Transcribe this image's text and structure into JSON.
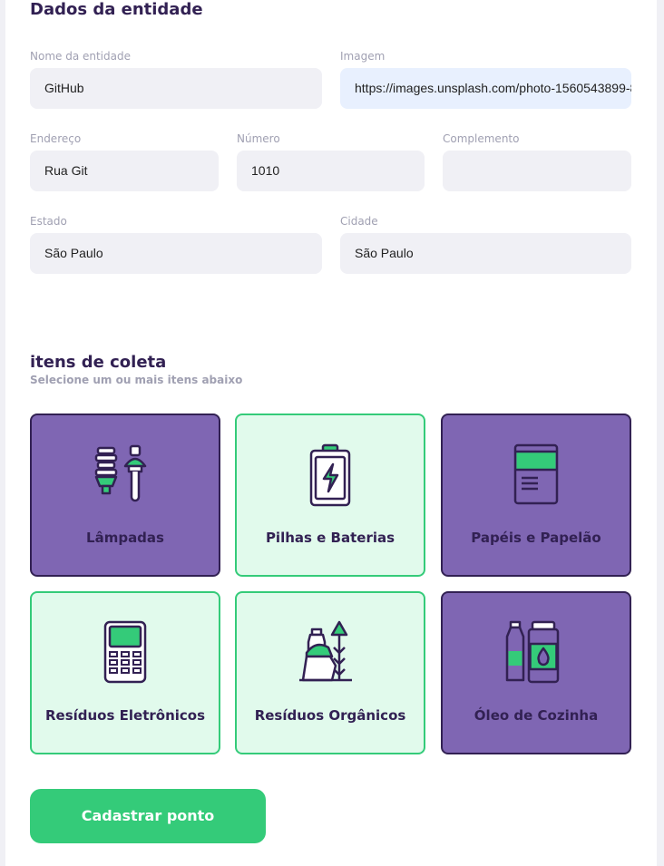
{
  "section_entity": {
    "title": "Dados da entidade",
    "name_label": "Nome da entidade",
    "name_value": "GitHub",
    "image_label": "Imagem",
    "image_value": "https://images.unsplash.com/photo-1560543899-8",
    "address_label": "Endereço",
    "address_value": "Rua Git",
    "number_label": "Número",
    "number_value": "1010",
    "complement_label": "Complemento",
    "complement_value": "",
    "state_label": "Estado",
    "state_value": "São Paulo",
    "city_label": "Cidade",
    "city_value": "São Paulo"
  },
  "section_items": {
    "title": "itens de coleta",
    "subtitle": "Selecione um ou mais itens abaixo",
    "items": [
      {
        "label": "Lâmpadas",
        "icon": "lamps-icon",
        "selected": true
      },
      {
        "label": "Pilhas e Baterias",
        "icon": "battery-icon",
        "selected": false
      },
      {
        "label": "Papéis e Papelão",
        "icon": "paper-icon",
        "selected": true
      },
      {
        "label": "Resíduos Eletrônicos",
        "icon": "electronics-icon",
        "selected": false
      },
      {
        "label": "Resíduos Orgânicos",
        "icon": "organic-icon",
        "selected": false
      },
      {
        "label": "Óleo de Cozinha",
        "icon": "oil-icon",
        "selected": true
      }
    ]
  },
  "submit_label": "Cadastrar ponto",
  "colors": {
    "primary": "#34cb79",
    "dark": "#322153",
    "selected_bg": "#7f66b3",
    "unselected_bg": "#e1faec"
  }
}
